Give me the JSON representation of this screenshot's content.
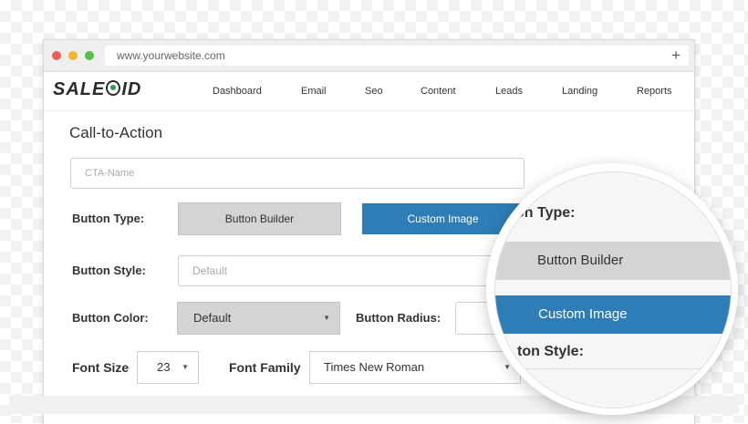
{
  "browser": {
    "url": "www.yourwebsite.com",
    "new_tab": "+"
  },
  "nav": {
    "logo": "SALEOID",
    "items": [
      "Dashboard",
      "Email",
      "Seo",
      "Content",
      "Leads",
      "Landing",
      "Reports"
    ]
  },
  "form": {
    "title": "Call-to-Action",
    "cta_name_placeholder": "CTA-Name",
    "button_type_label": "Button Type:",
    "button_builder": "Button Builder",
    "custom_image": "Custom Image",
    "button_style_label": "Button Style:",
    "button_style_value": "Default",
    "button_color_label": "Button Color:",
    "button_color_value": "Default",
    "button_radius_label": "Button Radius:",
    "font_size_label": "Font Size",
    "font_size_value": "23",
    "font_family_label": "Font Family",
    "font_family_value": "Times New Roman"
  },
  "magnifier": {
    "type_label_partial": "on Type:",
    "button_builder": "Button Builder",
    "custom_image": "Custom Image",
    "style_label_partial": "ton Style:"
  },
  "colors": {
    "accent_blue": "#2e7db6",
    "button_grey": "#d5d3d3"
  }
}
